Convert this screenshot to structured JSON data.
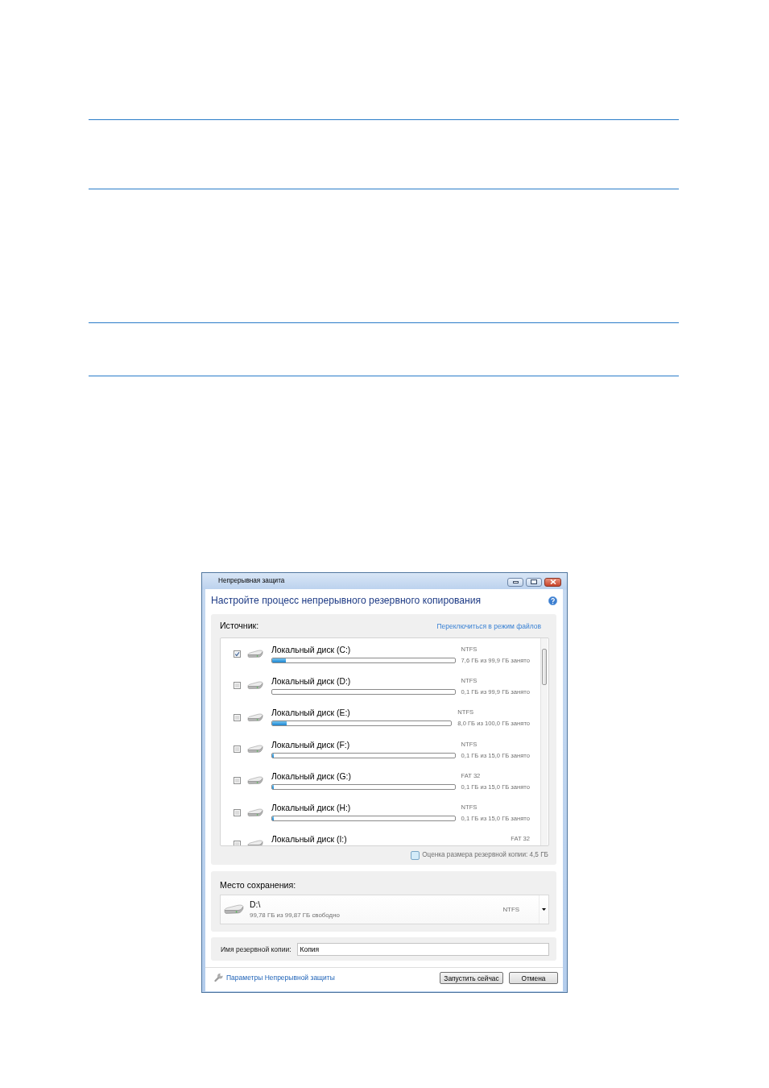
{
  "window": {
    "title": "Непрерывная защита"
  },
  "heading": "Настройте процесс непрерывного резервного копирования",
  "source": {
    "label": "Источник:",
    "switch_link": "Переключиться в режим файлов",
    "disks": [
      {
        "name": "Локальный диск (C:)",
        "checked": true,
        "fs": "NTFS",
        "usage": "7,6 ГБ из 99,9 ГБ занято",
        "level": 0.076
      },
      {
        "name": "Локальный диск (D:)",
        "checked": false,
        "fs": "NTFS",
        "usage": "0,1 ГБ из 99,9 ГБ занято",
        "level": 0.001
      },
      {
        "name": "Локальный диск (E:)",
        "checked": false,
        "fs": "NTFS",
        "usage": "8,0 ГБ из 100,0 ГБ занято",
        "level": 0.08
      },
      {
        "name": "Локальный диск (F:)",
        "checked": false,
        "fs": "NTFS",
        "usage": "0,1 ГБ из 15,0 ГБ занято",
        "level": 0.007
      },
      {
        "name": "Локальный диск (G:)",
        "checked": false,
        "fs": "FAT 32",
        "usage": "0,1 ГБ из 15,0 ГБ занято",
        "level": 0.007
      },
      {
        "name": "Локальный диск (H:)",
        "checked": false,
        "fs": "NTFS",
        "usage": "0,1 ГБ из 15,0 ГБ занято",
        "level": 0.007
      },
      {
        "name": "Локальный диск (I:)",
        "checked": false,
        "fs": "FAT 32"
      }
    ],
    "estimate": {
      "checked": false,
      "text": "Оценка размера резервной копии: 4,5 ГБ"
    }
  },
  "destination": {
    "label": "Место сохранения:",
    "drive": "D:\\",
    "free": "99,78 ГБ из 99,87 ГБ свободно",
    "fs": "NTFS"
  },
  "backup_name": {
    "label": "Имя резервной копии:",
    "value": "Копия"
  },
  "footer": {
    "settings_link": "Параметры Непрерывной защиты",
    "buttons": [
      "Запустить сейчас",
      "Отмена"
    ]
  }
}
